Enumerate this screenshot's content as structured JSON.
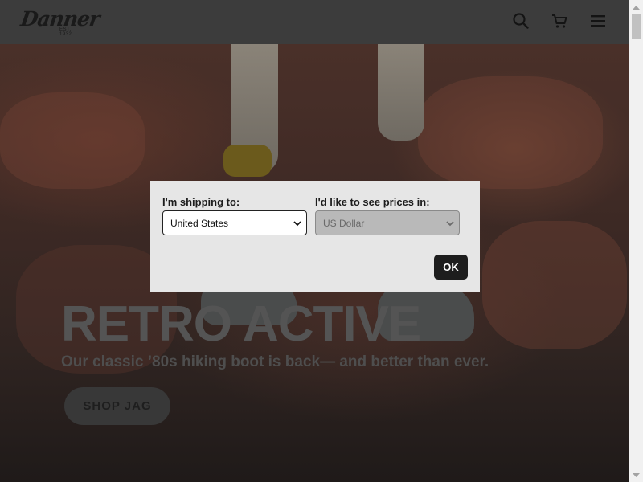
{
  "header": {
    "logo_text": "Danner",
    "logo_est": "EST. 1932",
    "icons": [
      "search-icon",
      "cart-icon",
      "menu-icon"
    ]
  },
  "hero": {
    "headline": "RETRO ACTIVE",
    "subline": "Our classic ’80s hiking boot is back— and better than ever.",
    "cta_label": "SHOP JAG"
  },
  "modal": {
    "shipping_label": "I'm shipping to:",
    "shipping_value": "United States",
    "currency_label": "I'd like to see prices in:",
    "currency_value": "US Dollar",
    "ok_label": "OK"
  },
  "colors": {
    "header_bg": "#3c3c3c",
    "modal_bg": "#e6e6e6",
    "ok_bg": "#1d1d1d"
  }
}
